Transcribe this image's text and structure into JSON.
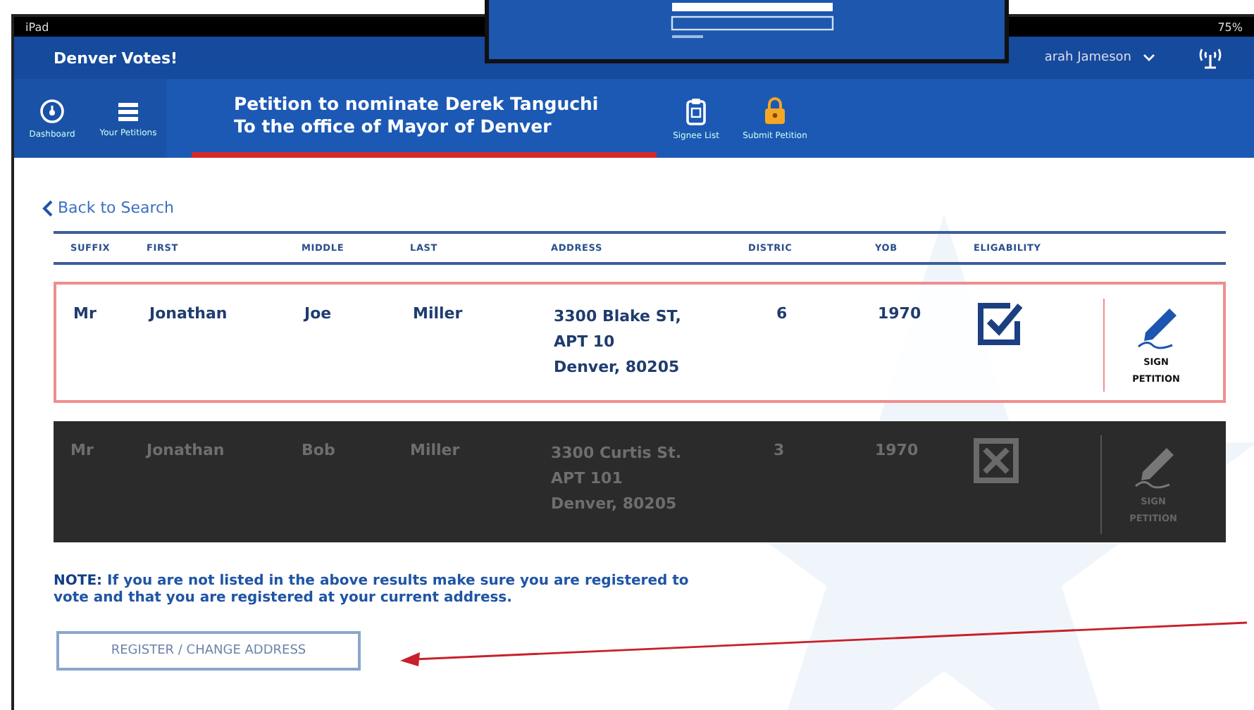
{
  "status_bar": {
    "device": "iPad",
    "battery": "75%"
  },
  "header": {
    "app_title": "Denver Votes!",
    "user": "arah Jameson"
  },
  "nav": {
    "left_items": [
      {
        "kind": "dashboard",
        "label": "Dashboard"
      },
      {
        "kind": "petitions",
        "label": "Your Petitions"
      }
    ],
    "title_lines": [
      "Petition to nominate Derek Tanguchi",
      "To the office of Mayor of Denver"
    ],
    "right_items": [
      {
        "kind": "signee",
        "label": "Signee List"
      },
      {
        "kind": "submit",
        "label": "Submit Petition"
      }
    ]
  },
  "back_link": "Back to Search",
  "table": {
    "columns": [
      "SUFFIX",
      "FIRST",
      "MIDDLE",
      "LAST",
      "ADDRESS",
      "DISTRIC",
      "YOB",
      "ELIGABILITY"
    ],
    "rows": [
      {
        "suffix": "Mr",
        "first": "Jonathan",
        "middle": "Joe",
        "last": "Miller",
        "address": [
          "3300 Blake ST,",
          "APT 10",
          "Denver, 80205"
        ],
        "district": "6",
        "yob": "1970",
        "eligible": true,
        "sign_label": [
          "SIGN",
          "PETITION"
        ]
      },
      {
        "suffix": "Mr",
        "first": "Jonathan",
        "middle": "Bob",
        "last": "Miller",
        "address": [
          "3300 Curtis St.",
          "APT 101",
          "Denver, 80205"
        ],
        "district": "3",
        "yob": "1970",
        "eligible": false,
        "sign_label": [
          "SIGN",
          "PETITION"
        ]
      }
    ]
  },
  "note": "**NOTE:** If you are not listed in the above results make sure you are registered to vote and that you are registered at your current address.",
  "register_button": "REGISTER / CHANGE ADDRESS"
}
